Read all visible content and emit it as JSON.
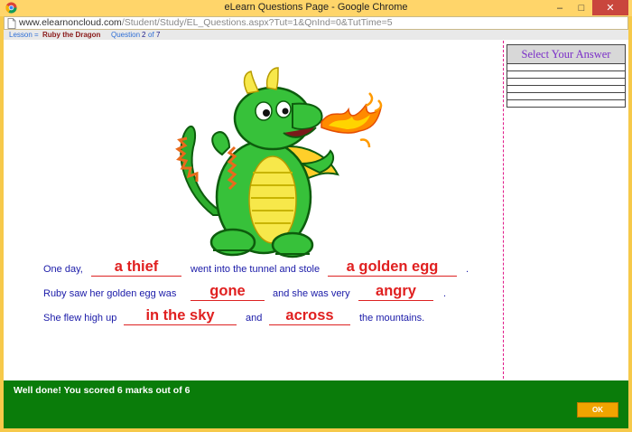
{
  "window": {
    "title": "eLearn Questions Page - Google Chrome",
    "url_domain": "www.elearnoncloud.com",
    "url_path": "/Student/Study/EL_Questions.aspx?Tut=1&QnInd=0&TutTime=5"
  },
  "lesson_bar": {
    "lesson_label": "Lesson",
    "separator": "=",
    "lesson_name": "Ruby the Dragon",
    "question_label": "Question",
    "question_current": "2",
    "question_of": "of",
    "question_total": "7"
  },
  "answer_panel": {
    "title": "Select Your Answer",
    "colors": {
      "title": "#7b2fc8"
    }
  },
  "sentences": [
    {
      "parts": [
        "One day,",
        "went into the tunnel and stole",
        "."
      ],
      "answers": [
        "a thief",
        "a golden egg"
      ]
    },
    {
      "parts": [
        "Ruby saw her golden egg was",
        "and she was very",
        "."
      ],
      "answers": [
        "gone",
        "angry"
      ]
    },
    {
      "parts": [
        "She flew high up",
        "and",
        "the mountains."
      ],
      "answers": [
        "in the sky",
        "across"
      ]
    }
  ],
  "footer": {
    "score_text": "Well done! You scored 6 marks out of 6",
    "ok_label": "OK",
    "colors": {
      "background": "#0a7c0a",
      "ok_button": "#f0a400"
    }
  },
  "icons": [
    "chrome-icon",
    "page-icon",
    "minimize-icon",
    "maximize-icon",
    "close-icon",
    "dragon-illustration"
  ]
}
